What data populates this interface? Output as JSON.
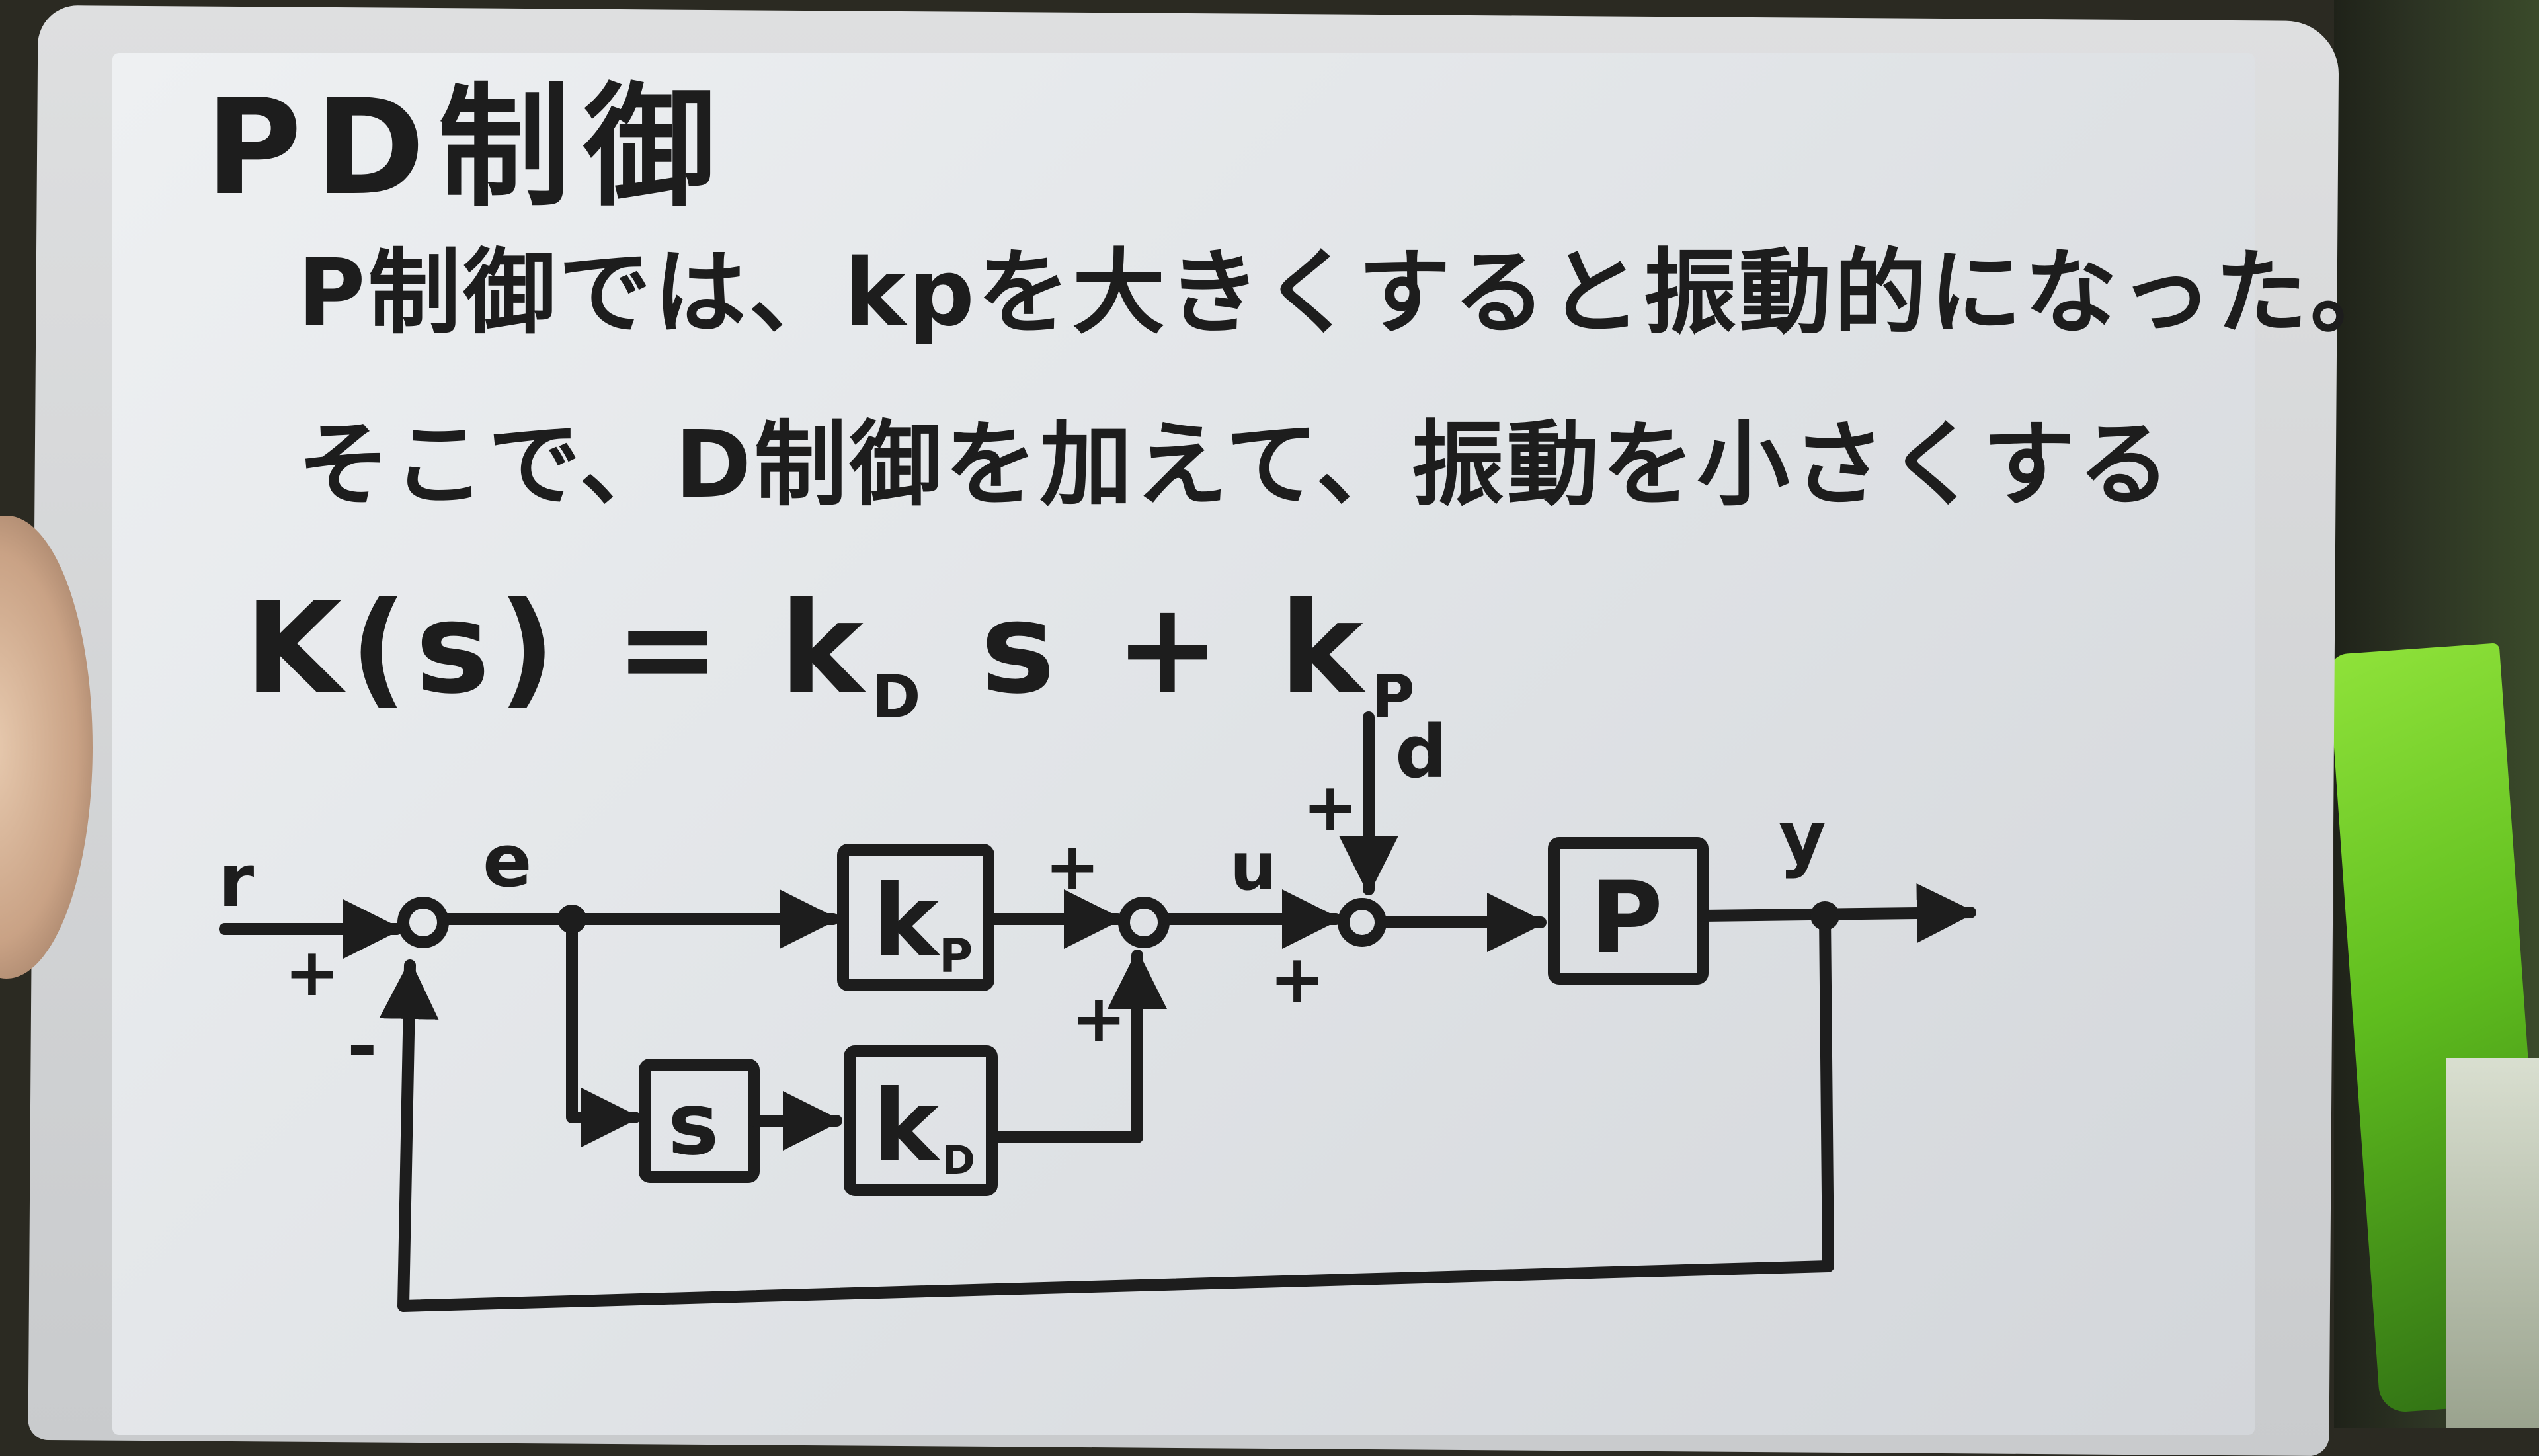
{
  "title": "PD制御",
  "text_lines": [
    "P制御では、kpを大きくすると振動的になった。",
    "そこで、D制御を加えて、振動を小さくする"
  ],
  "formula": {
    "lhs": "K(s)",
    "equals": "=",
    "term1_coef": "k",
    "term1_sub": "D",
    "term1_var": "s",
    "plus": "+",
    "term2_coef": "k",
    "term2_sub": "P"
  },
  "block_diagram": {
    "signals": {
      "reference": "r",
      "error": "e",
      "input": "u",
      "disturbance": "d",
      "output": "y"
    },
    "blocks": {
      "kp": {
        "main": "k",
        "sub": "P"
      },
      "s": {
        "main": "s"
      },
      "kd": {
        "main": "k",
        "sub": "D"
      },
      "plant": {
        "main": "P"
      }
    },
    "signs": {
      "sum1_ref": "+",
      "sum1_feedback": "-",
      "sum2_kp": "+",
      "sum2_kd": "+",
      "sum3_u": "+",
      "sum3_d": "+"
    }
  },
  "colors": {
    "ink": "#1d1d1d",
    "board": "#e6e8ea",
    "frame": "#d2d4d6"
  }
}
